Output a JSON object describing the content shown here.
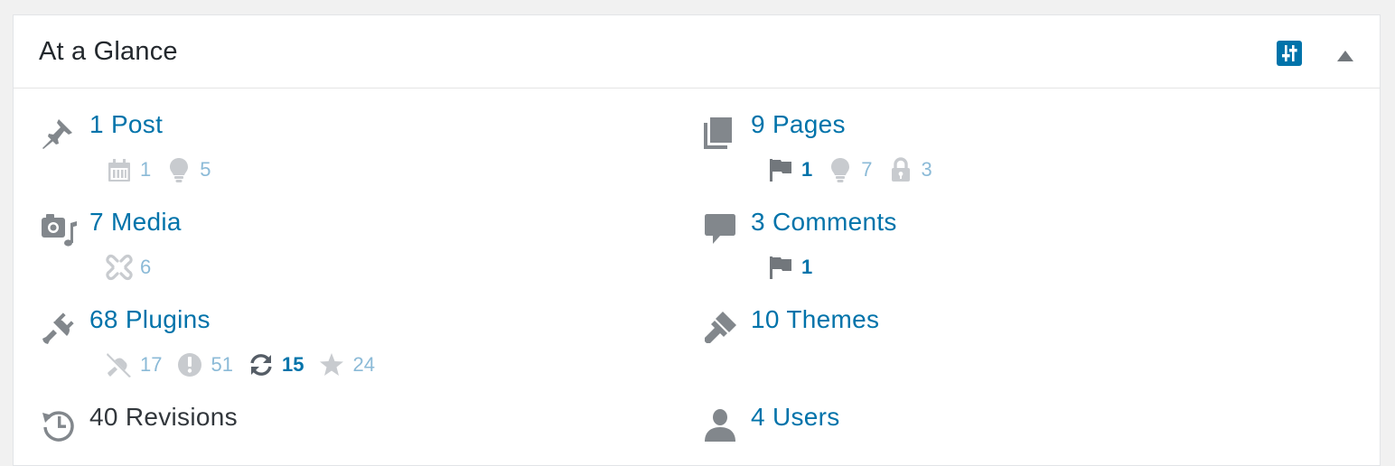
{
  "widget": {
    "title": "At a Glance"
  },
  "left": {
    "posts": {
      "label": "1 Post",
      "scheduled": "1",
      "drafts": "5"
    },
    "media": {
      "label": "7 Media",
      "unattached": "6"
    },
    "plugins": {
      "label": "68 Plugins",
      "inactive": "17",
      "must_use": "51",
      "updates": "15",
      "recent": "24"
    },
    "revisions": {
      "label": "40 Revisions"
    }
  },
  "right": {
    "pages": {
      "label": "9 Pages",
      "flagged": "1",
      "drafts": "7",
      "private": "3"
    },
    "comments": {
      "label": "3 Comments",
      "flagged": "1"
    },
    "themes": {
      "label": "10 Themes"
    },
    "users": {
      "label": "4 Users"
    }
  },
  "colors": {
    "link": "#0073aa",
    "muted_link": "#8bbad7",
    "icon": "#82878c",
    "icon_light": "#c8cbcf"
  }
}
